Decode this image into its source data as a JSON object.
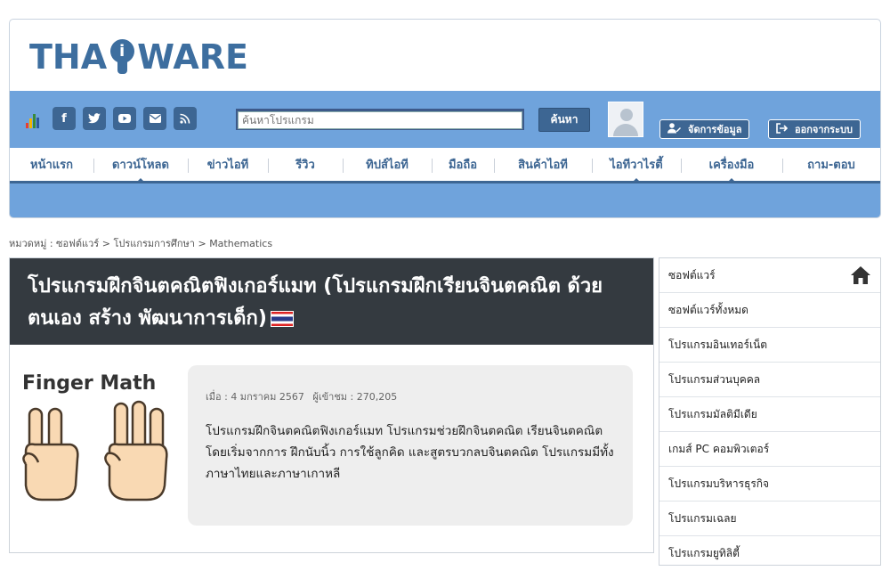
{
  "brand": {
    "logo_left": "THA",
    "logo_i": "i",
    "logo_right": "WARE"
  },
  "colors": {
    "primary": "#3d6693",
    "band": "#6fa3dc",
    "title_bg": "#343a40",
    "desc_bg": "#eeeeee"
  },
  "social_icons": [
    "facebook-icon",
    "twitter-icon",
    "youtube-icon",
    "mail-icon",
    "rss-icon"
  ],
  "search": {
    "placeholder": "ค้นหาโปรแกรม",
    "button": "ค้นหา"
  },
  "account": {
    "manage": "จัดการข้อมูล",
    "logout": "ออกจากระบบ"
  },
  "nav": [
    {
      "label": "หน้าแรก",
      "w": 94
    },
    {
      "label": "ดาวน์โหลด",
      "w": 106,
      "marker": true
    },
    {
      "label": "ข่าวไอที",
      "w": 90
    },
    {
      "label": "รีวิว",
      "w": 84
    },
    {
      "label": "ทิปส์ไอที",
      "w": 100
    },
    {
      "label": "มือถือ",
      "w": 70
    },
    {
      "label": "สินค้าไอที",
      "w": 110
    },
    {
      "label": "ไอทีวาไรตี้",
      "w": 100,
      "marker": true
    },
    {
      "label": "เครื่องมือ",
      "w": 114,
      "marker": true
    },
    {
      "label": "ถาม-ตอบ",
      "w": 110
    }
  ],
  "breadcrumb": {
    "label": "หมวดหมู่ :",
    "items": [
      "ซอฟต์แวร์",
      "โปรแกรมการศึกษา",
      "Mathematics"
    ],
    "sep": ">"
  },
  "article": {
    "title": "โปรแกรมฝึกจินตคณิตฟิงเกอร์แมท (โปรแกรมฝึกเรียนจินตคณิต ด้วยตนเอง สร้าง พัฒนาการเด็ก)",
    "thumb_caption": "Finger Math",
    "date": "เมื่อ : 4 มกราคม 2567",
    "views": "ผู้เข้าชม : 270,205",
    "description": "โปรแกรมฝึกจินตคณิตฟิงเกอร์แมท โปรแกรมช่วยฝึกจินตคณิต เรียนจินตคณิต โดยเริ่มจากการ ฝึกนับนิ้ว การใช้ลูกคิด และสูตรบวกลบจินตคณิต โปรแกรมมีทั้งภาษาไทยและภาษาเกาหลี"
  },
  "sidebar": {
    "header": "ซอฟต์แวร์",
    "items": [
      "ซอฟต์แวร์ทั้งหมด",
      "โปรแกรมอินเทอร์เน็ต",
      "โปรแกรมส่วนบุคคล",
      "โปรแกรมมัลติมีเดีย",
      "เกมส์ PC คอมพิวเตอร์",
      "โปรแกรมบริหารธุรกิจ",
      "โปรแกรมเฉลย",
      "โปรแกรมยูทิลิตี้"
    ]
  }
}
